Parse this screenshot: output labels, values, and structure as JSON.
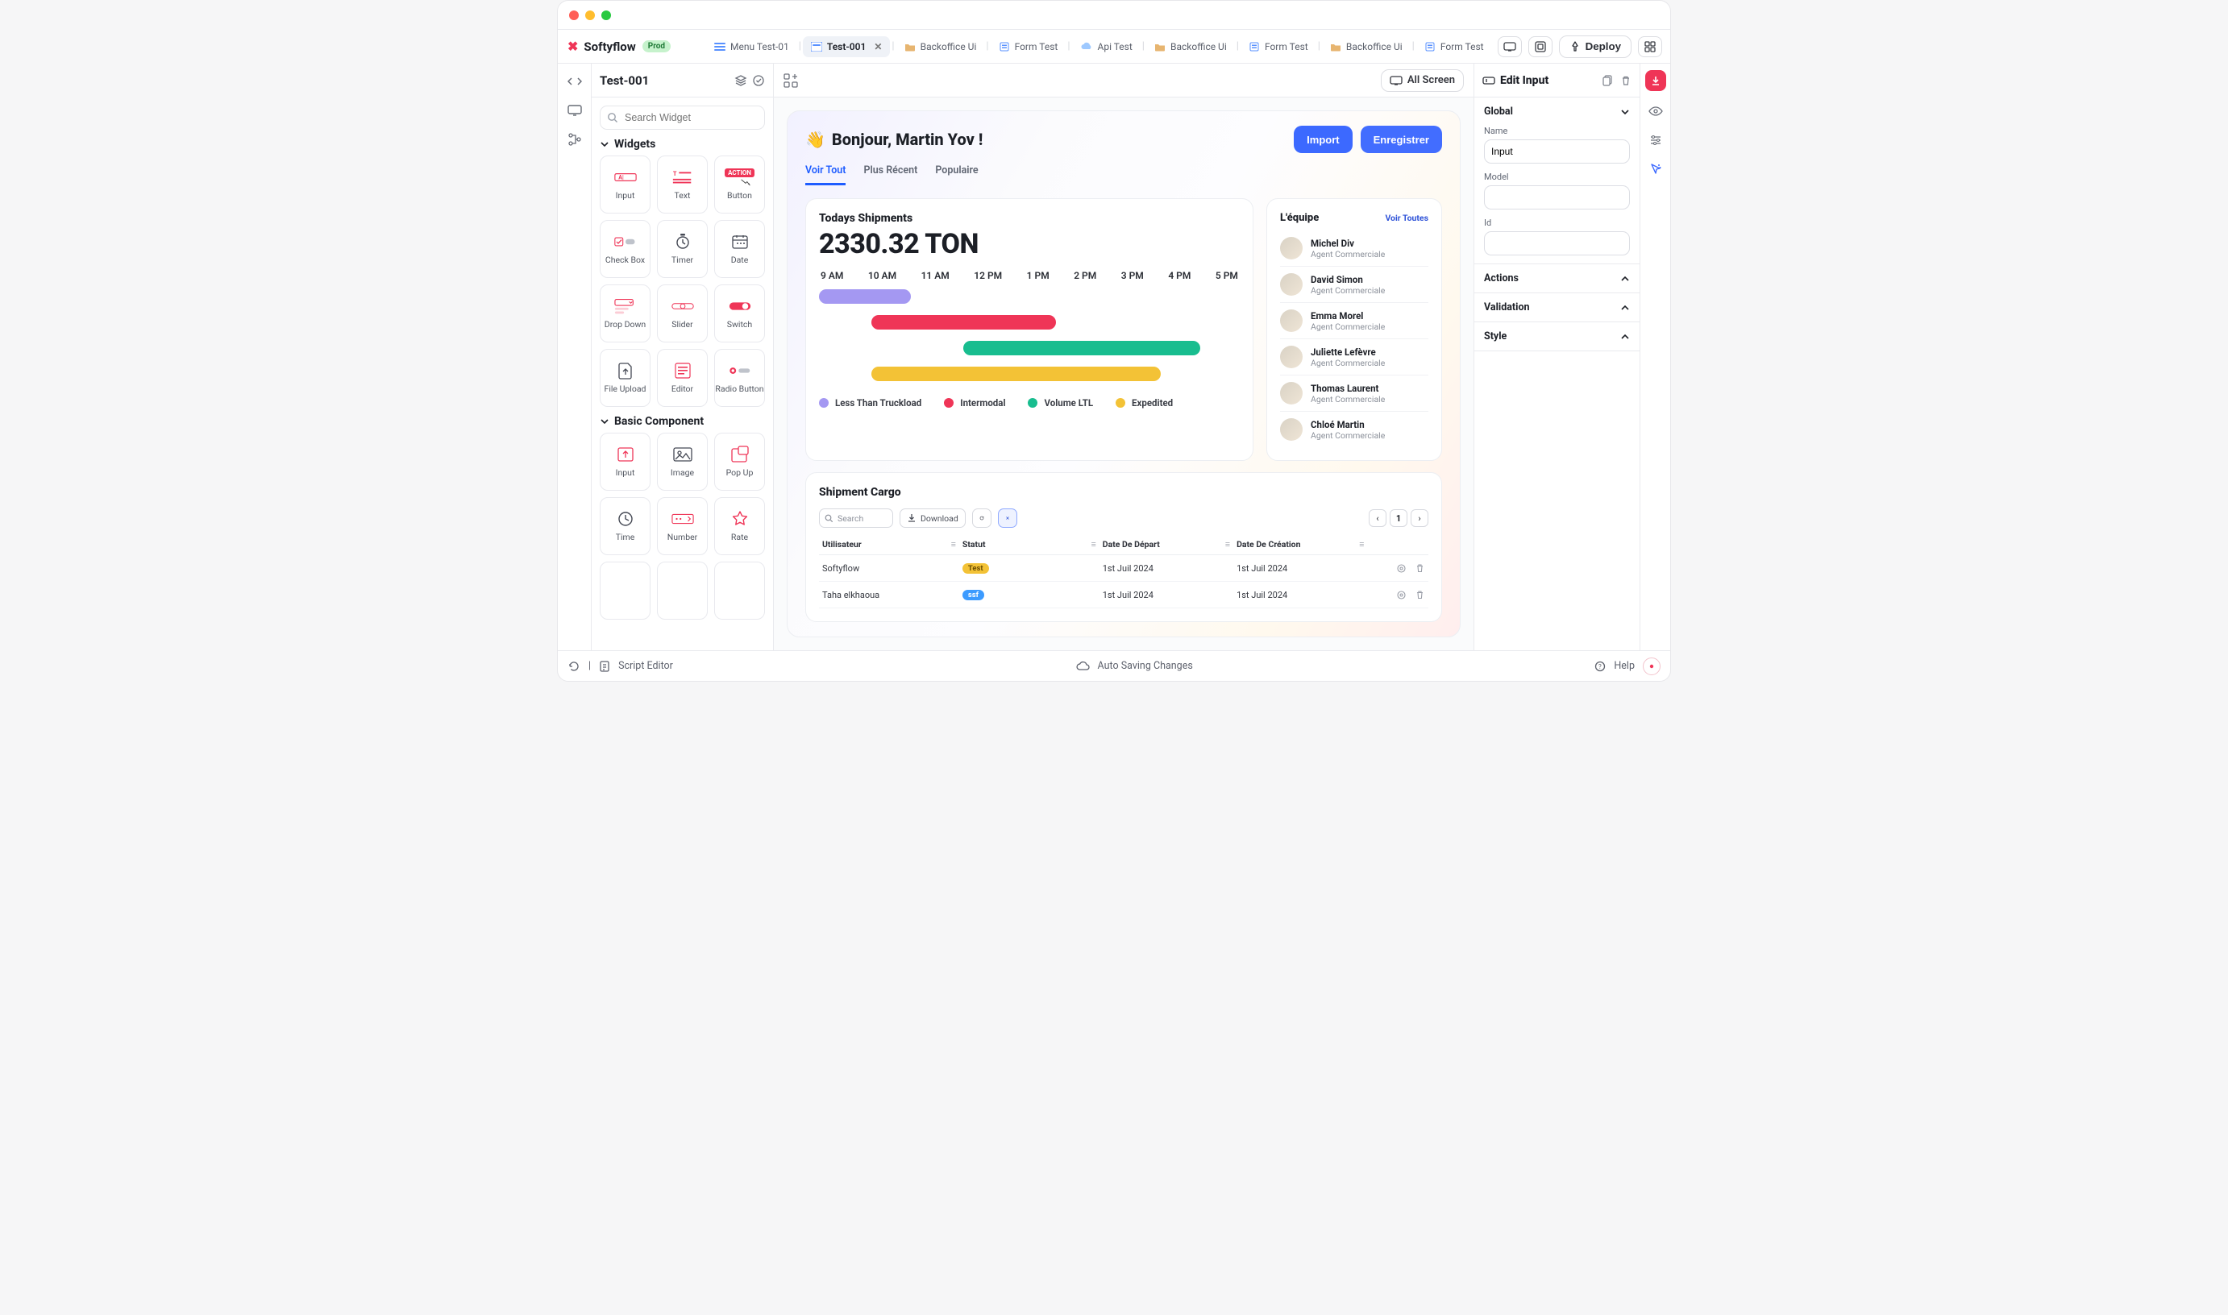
{
  "brand": {
    "name": "Softyflow",
    "env": "Prod"
  },
  "header": {
    "tabs": [
      {
        "type": "menu",
        "label": "Menu Test-01"
      },
      {
        "type": "ui",
        "label": "Test-001",
        "active": true,
        "closable": true
      },
      {
        "type": "folder",
        "label": "Backoffice Ui"
      },
      {
        "type": "form",
        "label": "Form Test"
      },
      {
        "type": "api",
        "label": "Api Test"
      },
      {
        "type": "folder",
        "label": "Backoffice Ui"
      },
      {
        "type": "form",
        "label": "Form Test"
      },
      {
        "type": "folder",
        "label": "Backoffice Ui"
      },
      {
        "type": "form",
        "label": "Form Test"
      }
    ],
    "deploy_label": "Deploy"
  },
  "left": {
    "title": "Test-001",
    "search_placeholder": "Search Widget",
    "section_widgets_title": "Widgets",
    "section_basic_title": "Basic Component",
    "widgets": [
      "Input",
      "Text",
      "Button",
      "Check Box",
      "Timer",
      "Date",
      "Drop Down",
      "Slider",
      "Switch",
      "File Upload",
      "Editor",
      "Radio Button"
    ],
    "basic": [
      "Input",
      "Image",
      "Pop Up",
      "Time",
      "Number",
      "Rate"
    ]
  },
  "canvas": {
    "allscreen_label": "All Screen",
    "greeting": "Bonjour, Martin Yov !",
    "wave": "👋",
    "import_label": "Import",
    "save_label": "Enregistrer",
    "tabs": {
      "viewall": "Voir Tout",
      "recent": "Plus Récent",
      "popular": "Populaire"
    },
    "shipments_card_title": "Todays Shipments",
    "shipments_total": "2330.32 TON",
    "legend": {
      "ltl": "Less Than Truckload",
      "intermodal": "Intermodal",
      "volume": "Volume LTL",
      "expedited": "Expedited"
    },
    "team_card_title": "L'équipe",
    "team_link_label": "Voir Toutes",
    "team": [
      {
        "name": "Michel Div",
        "role": "Agent Commerciale"
      },
      {
        "name": "David Simon",
        "role": "Agent Commerciale"
      },
      {
        "name": "Emma Morel",
        "role": "Agent Commerciale"
      },
      {
        "name": "Juliette Lefèvre",
        "role": "Agent Commerciale"
      },
      {
        "name": "Thomas Laurent",
        "role": "Agent Commerciale"
      },
      {
        "name": "Chloé Martin",
        "role": "Agent Commerciale"
      }
    ],
    "cargo_title": "Shipment Cargo",
    "cargo_search_placeholder": "Search",
    "cargo_download_label": "Download",
    "cargo_page_number": "1",
    "cargo_columns": {
      "user": "Utilisateur",
      "status": "Statut",
      "departure": "Date De Départ",
      "created": "Date De Création"
    },
    "cargo_rows": [
      {
        "user": "Softyflow",
        "status": "Test",
        "status_color": "yellow",
        "departure": "1st Juil 2024",
        "created": "1st Juil 2024"
      },
      {
        "user": "Taha elkhaoua",
        "status": "ssf",
        "status_color": "blue",
        "departure": "1st Juil 2024",
        "created": "1st Juil 2024"
      }
    ]
  },
  "chart_data": {
    "type": "gantt",
    "x_categories": [
      "9 AM",
      "10 AM",
      "11 AM",
      "12 PM",
      "1 PM",
      "2 PM",
      "3 PM",
      "4 PM",
      "5 PM"
    ],
    "series": [
      {
        "name": "Less Than Truckload",
        "color": "#a498f2",
        "start": "9 AM",
        "end": "10:45 AM"
      },
      {
        "name": "Intermodal",
        "color": "#ef3557",
        "start": "10 AM",
        "end": "1:30 PM"
      },
      {
        "name": "Volume LTL",
        "color": "#18bd8f",
        "start": "11:45 AM",
        "end": "4:15 PM"
      },
      {
        "name": "Expedited",
        "color": "#f3c236",
        "start": "10 AM",
        "end": "3:30 PM"
      }
    ],
    "xlabel": "",
    "ylabel": "",
    "xlim": [
      "9 AM",
      "5 PM"
    ]
  },
  "right": {
    "panel_title": "Edit Input",
    "groups": {
      "global": "Global",
      "actions": "Actions",
      "validation": "Validation",
      "style": "Style"
    },
    "labels": {
      "name": "Name",
      "model": "Model",
      "id": "Id"
    },
    "values": {
      "name": "Input",
      "model": "",
      "id": ""
    }
  },
  "footer": {
    "script_editor": "Script Editor",
    "autosave": "Auto Saving Changes",
    "help": "Help"
  }
}
